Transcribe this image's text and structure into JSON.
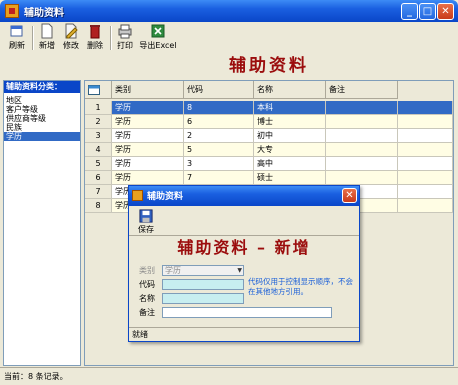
{
  "window": {
    "title": "辅助资料"
  },
  "toolbar": {
    "refresh": "刷新",
    "add": "新增",
    "edit": "修改",
    "delete": "删除",
    "print": "打印",
    "export": "导出Excel"
  },
  "banner": "辅助资料",
  "sidebar": {
    "header": "辅助资料分类：",
    "items": [
      "地区",
      "客户等级",
      "供应商等级",
      "民族",
      "学历"
    ],
    "selected": "学历"
  },
  "grid": {
    "headers": [
      "类别",
      "代码",
      "名称",
      "备注"
    ],
    "rows": [
      {
        "num": "1",
        "category": "学历",
        "code": "8",
        "name": "本科",
        "note": ""
      },
      {
        "num": "2",
        "category": "学历",
        "code": "6",
        "name": "博士",
        "note": ""
      },
      {
        "num": "3",
        "category": "学历",
        "code": "2",
        "name": "初中",
        "note": ""
      },
      {
        "num": "4",
        "category": "学历",
        "code": "5",
        "name": "大专",
        "note": ""
      },
      {
        "num": "5",
        "category": "学历",
        "code": "3",
        "name": "高中",
        "note": ""
      },
      {
        "num": "6",
        "category": "学历",
        "code": "7",
        "name": "硕士",
        "note": ""
      },
      {
        "num": "7",
        "category": "学历",
        "code": "",
        "name": "",
        "note": ""
      },
      {
        "num": "8",
        "category": "学历",
        "code": "",
        "name": "",
        "note": ""
      }
    ]
  },
  "status": "当前：8 条记录。",
  "dialog": {
    "title": "辅助资料",
    "save": "保存",
    "banner": "辅助资料 – 新增",
    "labels": {
      "category": "类别",
      "code": "代码",
      "name": "名称",
      "note": "备注"
    },
    "category_value": "学历",
    "hint": "代码仅用于控制显示顺序，不会在其他地方引用。",
    "status": "就绪"
  },
  "colors": {
    "banner": "#9b0d0d",
    "selection": "#316ac5",
    "hint": "#1a5fd8",
    "input_bg": "#c7eef0"
  }
}
